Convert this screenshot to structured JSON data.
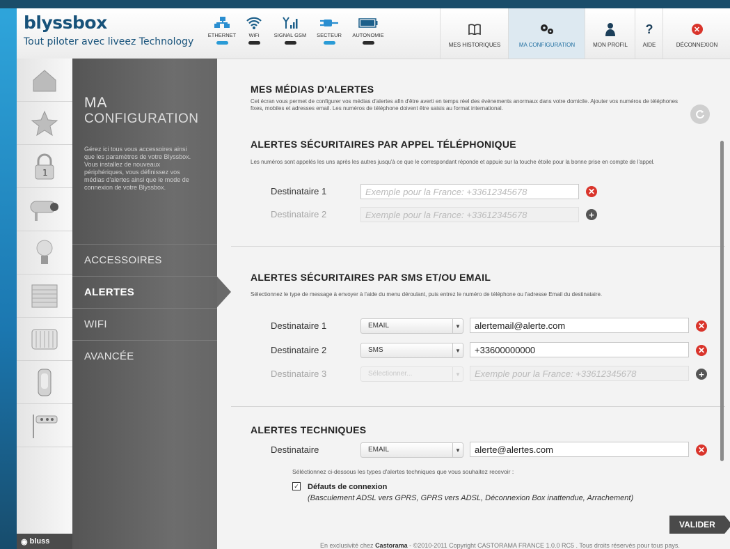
{
  "brand": {
    "logo": "blyssbox",
    "tagline": "Tout piloter avec liveez Technology"
  },
  "status_items": [
    {
      "label": "ETHERNET",
      "icon": "ethernet-icon",
      "state": "on"
    },
    {
      "label": "WiFi",
      "icon": "wifi-icon",
      "state": "off"
    },
    {
      "label": "SIGNAL GSM",
      "icon": "gsm-signal-icon",
      "state": "off"
    },
    {
      "label": "SECTEUR",
      "icon": "power-plug-icon",
      "state": "on"
    },
    {
      "label": "AUTONOMIE",
      "icon": "battery-icon",
      "state": "off"
    }
  ],
  "nav": [
    {
      "label": "MES HISTORIQUES",
      "icon": "book-icon"
    },
    {
      "label": "MA CONFIGURATION",
      "icon": "gears-icon",
      "active": true
    },
    {
      "label": "MON PROFIL",
      "icon": "user-icon"
    },
    {
      "label": "AIDE",
      "icon": "help-icon"
    },
    {
      "label": "DÉCONNEXION",
      "icon": "logout-icon"
    }
  ],
  "device_icons": [
    "house-icon",
    "star-icon",
    "padlock-icon",
    "camera-icon",
    "lightbulb-icon",
    "shutter-icon",
    "radiator-icon",
    "detector-icon",
    "sensor-icon"
  ],
  "footer_brand": "bluss",
  "panel": {
    "title_line1": "MA",
    "title_line2": "CONFIGURATION",
    "description": "Gérez ici tous vous accessoires ainsi que les paramètres de votre Blyssbox. Vous installez de nouveaux périphériques, vous définissez vos médias d'alertes ainsi que le mode de connexion de votre Blyssbox.",
    "menu": [
      "ACCESSOIRES",
      "ALERTES",
      "WIFI",
      "AVANCÉE"
    ],
    "active_menu": "ALERTES"
  },
  "content": {
    "medias": {
      "title": "MES MÉDIAS D'ALERTES",
      "description": "Cet écran vous permet de configurer vos médias d'alertes afin d'être averti en temps réel des événements anormaux dans votre domicile. Ajouter vos numéros de téléphones fixes, mobiles et adresses email. Les numéros de téléphone doivent être saisis au format international."
    },
    "phone": {
      "title": "ALERTES SÉCURITAIRES PAR APPEL TÉLÉPHONIQUE",
      "description": "Les numéros sont appelés les uns après les autres jusqu'à ce que le correspondant réponde et appuie sur la touche étoile pour la bonne prise en compte de l'appel.",
      "rows": [
        {
          "label": "Destinataire 1",
          "value": "",
          "placeholder": "Exemple pour la France: +33612345678"
        },
        {
          "label": "Destinataire 2",
          "value": "",
          "placeholder": "Exemple pour la France: +33612345678"
        }
      ]
    },
    "sms": {
      "title": "ALERTES SÉCURITAIRES PAR SMS ET/OU EMAIL",
      "description": "Sélectionnez le type de message à envoyer à l'aide du menu déroulant, puis entrez le numéro de téléphone ou l'adresse Email du destinataire.",
      "rows": [
        {
          "label": "Destinataire 1",
          "type": "EMAIL",
          "value": "alertemail@alerte.com",
          "placeholder": ""
        },
        {
          "label": "Destinataire 2",
          "type": "SMS",
          "value": "+33600000000",
          "placeholder": ""
        },
        {
          "label": "Destinataire 3",
          "type": "Sélectionner...",
          "value": "",
          "placeholder": "Exemple pour la France: +33612345678"
        }
      ]
    },
    "tech": {
      "title": "ALERTES TECHNIQUES",
      "label": "Destinataire",
      "type": "EMAIL",
      "value": "alerte@alertes.com",
      "description": "Séléctionnez ci-dessous les types d'alertes techniques que vous souhaitez recevoir :",
      "checkbox_title": "Défauts de connexion",
      "checkbox_checked": true,
      "checkbox_detail": "(Basculement ADSL vers GPRS, GPRS vers ADSL, Déconnexion Box inattendue, Arrachement)"
    },
    "submit": "VALIDER"
  },
  "footer": {
    "prefix": "En exclusivité chez",
    "brand": "Castorama",
    "suffix": " - ©2010-2011 Copyright CASTORAMA FRANCE 1.0.0 RC5 . Tous droits réservés pour tous pays."
  },
  "colors": {
    "accent": "#2a9bd6",
    "brand": "#17527a",
    "danger": "#d9342b",
    "panel": "#5f5f5f"
  }
}
